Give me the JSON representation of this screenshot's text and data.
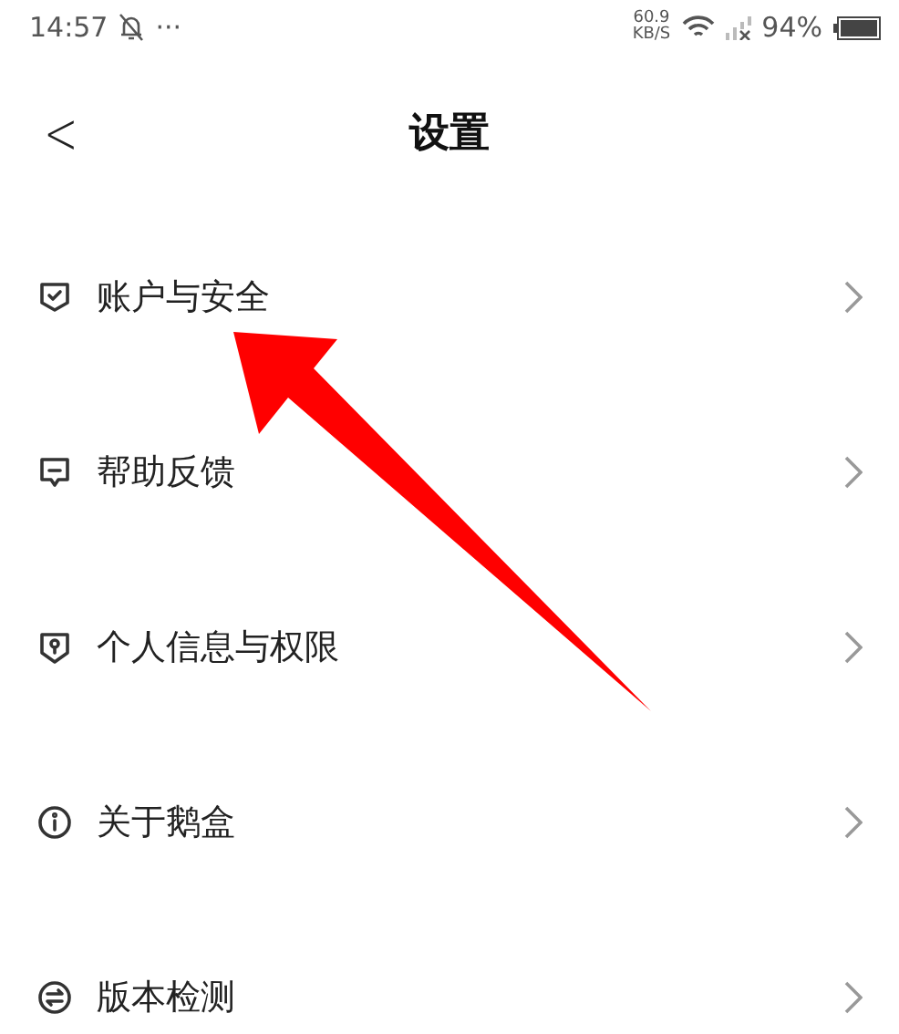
{
  "status_bar": {
    "time": "14:57",
    "more": "···",
    "speed_value": "60.9",
    "speed_unit": "KB/S",
    "battery": "94%"
  },
  "header": {
    "back": "<",
    "title": "设置"
  },
  "items": [
    {
      "kind": "account",
      "label": "账户与安全"
    },
    {
      "kind": "feedback",
      "label": "帮助反馈"
    },
    {
      "kind": "privacy",
      "label": "个人信息与权限"
    },
    {
      "kind": "about",
      "label": "关于鹅盒"
    },
    {
      "kind": "version",
      "label": "版本检测"
    }
  ]
}
